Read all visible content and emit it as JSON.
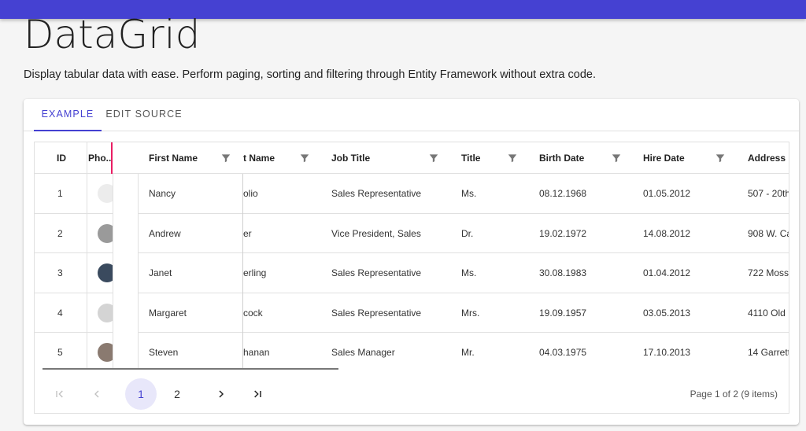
{
  "page": {
    "title": "DataGrid",
    "description": "Display tabular data with ease. Perform paging, sorting and filtering through Entity Framework without extra code."
  },
  "tabs": [
    {
      "label": "EXAMPLE",
      "active": true
    },
    {
      "label": "EDIT SOURCE",
      "active": false
    }
  ],
  "grid": {
    "columns": {
      "id": "ID",
      "photo": "Pho...",
      "first_name": "First Name",
      "last_name": "t Name",
      "job_title": "Job Title",
      "title": "Title",
      "birth_date": "Birth Date",
      "hire_date": "Hire Date",
      "address": "Address"
    },
    "rows": [
      {
        "id": "1",
        "first_name": "Nancy",
        "last_name": "olio",
        "job_title": "Sales Representative",
        "title": "Ms.",
        "birth_date": "08.12.1968",
        "hire_date": "01.05.2012",
        "address": "507 - 20th"
      },
      {
        "id": "2",
        "first_name": "Andrew",
        "last_name": "er",
        "job_title": "Vice President, Sales",
        "title": "Dr.",
        "birth_date": "19.02.1972",
        "hire_date": "14.08.2012",
        "address": "908 W. Ca"
      },
      {
        "id": "3",
        "first_name": "Janet",
        "last_name": "erling",
        "job_title": "Sales Representative",
        "title": "Ms.",
        "birth_date": "30.08.1983",
        "hire_date": "01.04.2012",
        "address": "722 Moss"
      },
      {
        "id": "4",
        "first_name": "Margaret",
        "last_name": "cock",
        "job_title": "Sales Representative",
        "title": "Mrs.",
        "birth_date": "19.09.1957",
        "hire_date": "03.05.2013",
        "address": "4110 Old I"
      },
      {
        "id": "5",
        "first_name": "Steven",
        "last_name": "hanan",
        "job_title": "Sales Manager",
        "title": "Mr.",
        "birth_date": "04.03.1975",
        "hire_date": "17.10.2013",
        "address": "14 Garrett"
      }
    ]
  },
  "pager": {
    "first_icon": "first-page-icon",
    "prev_icon": "chevron-left-icon",
    "next_icon": "chevron-right-icon",
    "last_icon": "last-page-icon",
    "pages": [
      "1",
      "2"
    ],
    "current_page": "1",
    "info": "Page 1 of 2 (9 items)"
  },
  "colors": {
    "accent": "#4541d2",
    "drag_indicator": "#e91e63",
    "active_page_bg": "#e8e7fa"
  }
}
